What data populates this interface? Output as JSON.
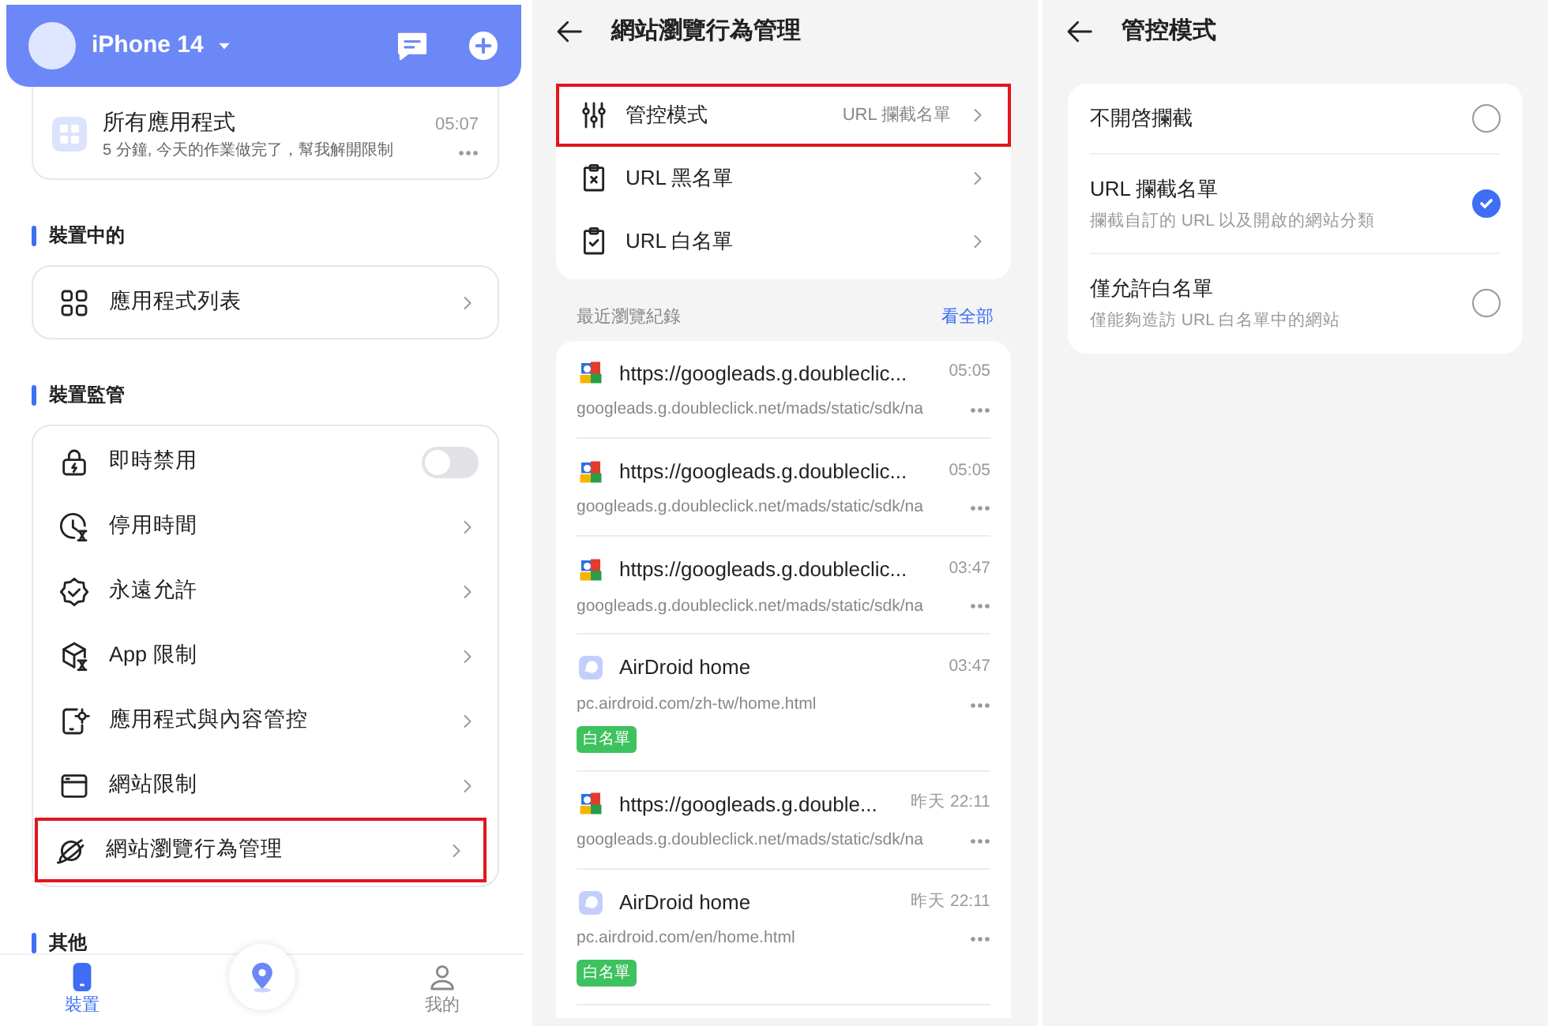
{
  "device_panel": {
    "device_name": "iPhone 14",
    "request_card": {
      "app": "所有應用程式",
      "time": "05:07",
      "message": "5 分鐘, 今天的作業做完了，幫我解開限制"
    },
    "sections": [
      {
        "title": "裝置中的",
        "items": [
          {
            "label": "應用程式列表",
            "kind": "link",
            "highlighted": false
          }
        ]
      },
      {
        "title": "裝置監管",
        "items": [
          {
            "label": "即時禁用",
            "kind": "toggle",
            "on": false,
            "highlighted": false
          },
          {
            "label": "停用時間",
            "kind": "link",
            "highlighted": false
          },
          {
            "label": "永遠允許",
            "kind": "link",
            "highlighted": false
          },
          {
            "label": "App 限制",
            "kind": "link",
            "highlighted": false
          },
          {
            "label": "應用程式與內容管控",
            "kind": "link",
            "highlighted": false
          },
          {
            "label": "網站限制",
            "kind": "link",
            "highlighted": false
          },
          {
            "label": "網站瀏覽行為管理",
            "kind": "link",
            "highlighted": true
          }
        ]
      },
      {
        "title": "其他"
      }
    ],
    "bottom_nav": [
      {
        "kind": "tab",
        "label": "裝置",
        "selected": true
      },
      {
        "kind": "center"
      },
      {
        "kind": "tab",
        "label": "我的",
        "selected": false
      }
    ]
  },
  "browsing_panel": {
    "title": "網站瀏覽行為管理",
    "settings": [
      {
        "label": "管控模式",
        "value": "URL 攔截名單",
        "highlighted": true
      },
      {
        "label": "URL 黑名單",
        "highlighted": false
      },
      {
        "label": "URL 白名單",
        "highlighted": false
      }
    ],
    "history_title": "最近瀏覽紀錄",
    "view_all": "看全部",
    "history": [
      {
        "kind": "google",
        "title": "https://googleads.g.doubleclic...",
        "time": "05:05",
        "url": "googleads.g.doubleclick.net/mads/static/sdk/na"
      },
      {
        "kind": "google",
        "title": "https://googleads.g.doubleclic...",
        "time": "05:05",
        "url": "googleads.g.doubleclick.net/mads/static/sdk/na"
      },
      {
        "kind": "google",
        "title": "https://googleads.g.doubleclic...",
        "time": "03:47",
        "url": "googleads.g.doubleclick.net/mads/static/sdk/na"
      },
      {
        "kind": "airdroid",
        "title": "AirDroid home",
        "time": "03:47",
        "url": "pc.airdroid.com/zh-tw/home.html",
        "tag": "白名單"
      },
      {
        "kind": "google",
        "title": "https://googleads.g.double...",
        "time": "昨天 22:11",
        "url": "googleads.g.doubleclick.net/mads/static/sdk/na"
      },
      {
        "kind": "airdroid",
        "title": "AirDroid home",
        "time": "昨天 22:11",
        "url": "pc.airdroid.com/en/home.html",
        "tag": "白名單"
      }
    ]
  },
  "mode_panel": {
    "title": "管控模式",
    "options": [
      {
        "label": "不開啓攔截",
        "selected": false
      },
      {
        "label": "URL 攔截名單",
        "description": "攔截自訂的 URL 以及開啟的網站分類",
        "selected": true
      },
      {
        "label": "僅允許白名單",
        "description": "僅能夠造訪 URL 白名單中的網站",
        "selected": false
      }
    ]
  }
}
